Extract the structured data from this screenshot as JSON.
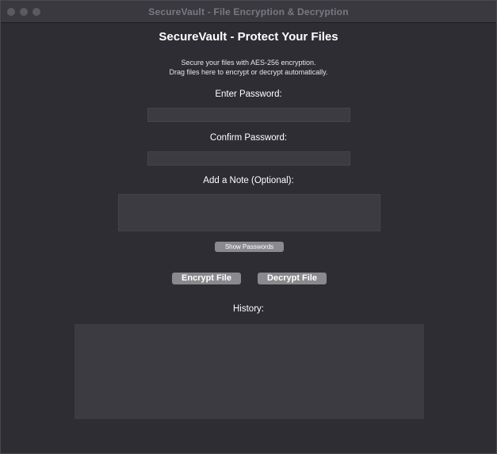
{
  "window": {
    "title": "SecureVault - File Encryption & Decryption"
  },
  "main": {
    "heading": "SecureVault - Protect Your Files",
    "description_line1": "Secure your files with AES-256 encryption.",
    "description_line2": "Drag files here to encrypt or decrypt automatically.",
    "password_label": "Enter Password:",
    "password_value": "",
    "confirm_label": "Confirm Password:",
    "confirm_value": "",
    "note_label": "Add a Note (Optional):",
    "note_value": "",
    "show_passwords_label": "Show Passwords",
    "encrypt_label": "Encrypt File",
    "decrypt_label": "Decrypt File",
    "history_label": "History:",
    "history_items": []
  },
  "colors": {
    "background": "#2e2d34",
    "field": "#3c3b42",
    "button": "#8a898e",
    "text": "#ffffff"
  }
}
